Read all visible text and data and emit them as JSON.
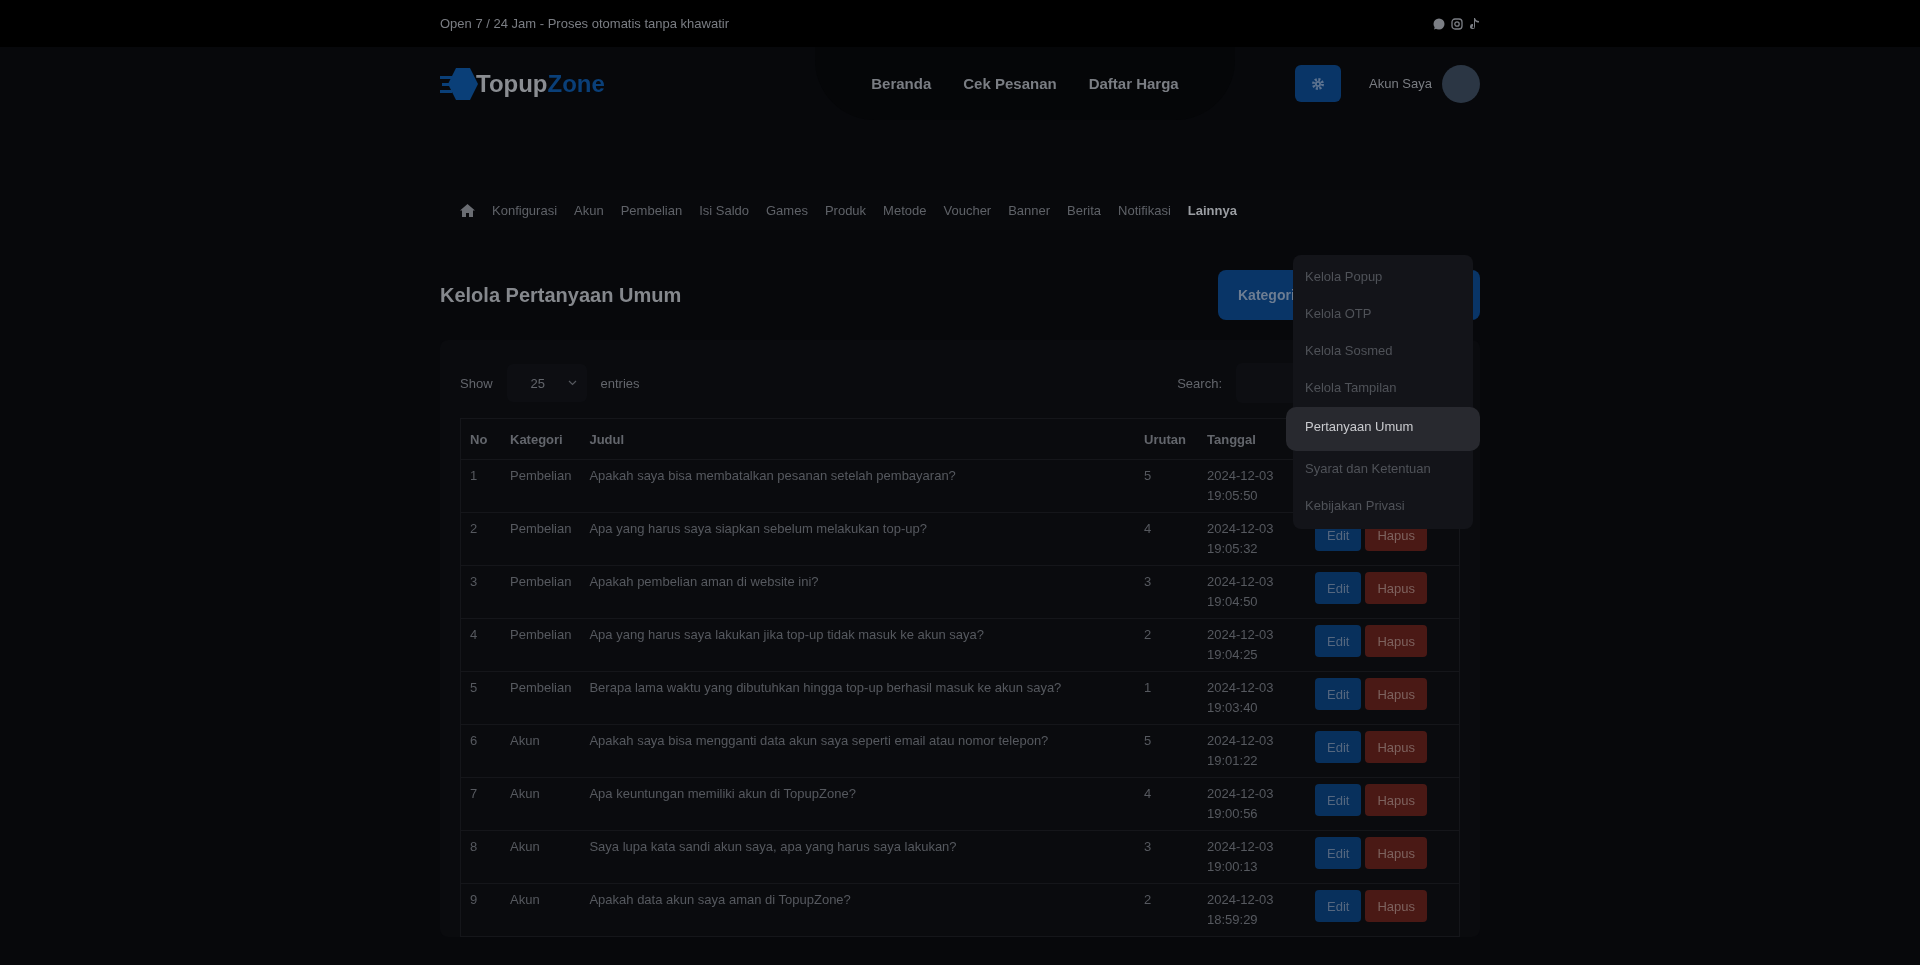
{
  "top_bar": {
    "tagline": "Open 7 / 24 Jam - Proses otomatis tanpa khawatir"
  },
  "header": {
    "logo": {
      "prefix": "Topup",
      "suffix": "Zone"
    },
    "nav": [
      "Beranda",
      "Cek Pesanan",
      "Daftar Harga"
    ],
    "account": "Akun Saya"
  },
  "admin_nav": {
    "items": [
      {
        "label": "Konfigurasi",
        "selected": false
      },
      {
        "label": "Akun",
        "selected": false
      },
      {
        "label": "Pembelian",
        "selected": false
      },
      {
        "label": "Isi Saldo",
        "selected": false
      },
      {
        "label": "Games",
        "selected": false
      },
      {
        "label": "Produk",
        "selected": false
      },
      {
        "label": "Metode",
        "selected": false
      },
      {
        "label": "Voucher",
        "selected": false
      },
      {
        "label": "Banner",
        "selected": false
      },
      {
        "label": "Berita",
        "selected": false
      },
      {
        "label": "Notifikasi",
        "selected": false
      },
      {
        "label": "Lainnya",
        "selected": true
      }
    ]
  },
  "dropdown": {
    "items": [
      {
        "label": "Kelola Popup",
        "selected": false
      },
      {
        "label": "Kelola OTP",
        "selected": false
      },
      {
        "label": "Kelola Sosmed",
        "selected": false
      },
      {
        "label": "Kelola Tampilan",
        "selected": false
      },
      {
        "label": "Pertanyaan Umum",
        "selected": true
      },
      {
        "label": "Syarat dan Ketentuan",
        "selected": false
      },
      {
        "label": "Kebijakan Privasi",
        "selected": false
      }
    ]
  },
  "page": {
    "title": "Kelola Pertanyaan Umum",
    "category_button": "Kategori"
  },
  "table_controls": {
    "show_label": "Show",
    "page_size": "25",
    "entries_label": "entries",
    "search_label": "Search:"
  },
  "table": {
    "columns": [
      "No",
      "Kategori",
      "Judul",
      "Urutan",
      "Tanggal"
    ],
    "rows": [
      {
        "cells": [
          "1",
          "Pembelian",
          "Apakah saya bisa membatalkan pesanan setelah pembayaran?",
          "5",
          "2024-12-03 19:05:50"
        ],
        "actions": []
      },
      {
        "cells": [
          "2",
          "Pembelian",
          "Apa yang harus saya siapkan sebelum melakukan top-up?",
          "4",
          "2024-12-03 19:05:32"
        ],
        "actions": [
          "Edit",
          "Hapus"
        ]
      },
      {
        "cells": [
          "3",
          "Pembelian",
          "Apakah pembelian aman di website ini?",
          "3",
          "2024-12-03 19:04:50"
        ],
        "actions": [
          "Edit",
          "Hapus"
        ]
      },
      {
        "cells": [
          "4",
          "Pembelian",
          "Apa yang harus saya lakukan jika top-up tidak masuk ke akun saya?",
          "2",
          "2024-12-03 19:04:25"
        ],
        "actions": [
          "Edit",
          "Hapus"
        ]
      },
      {
        "cells": [
          "5",
          "Pembelian",
          "Berapa lama waktu yang dibutuhkan hingga top-up berhasil masuk ke akun saya?",
          "1",
          "2024-12-03 19:03:40"
        ],
        "actions": [
          "Edit",
          "Hapus"
        ]
      },
      {
        "cells": [
          "6",
          "Akun",
          "Apakah saya bisa mengganti data akun saya seperti email atau nomor telepon?",
          "5",
          "2024-12-03 19:01:22"
        ],
        "actions": [
          "Edit",
          "Hapus"
        ]
      },
      {
        "cells": [
          "7",
          "Akun",
          "Apa keuntungan memiliki akun di TopupZone?",
          "4",
          "2024-12-03 19:00:56"
        ],
        "actions": [
          "Edit",
          "Hapus"
        ]
      },
      {
        "cells": [
          "8",
          "Akun",
          "Saya lupa kata sandi akun saya, apa yang harus saya lakukan?",
          "3",
          "2024-12-03 19:00:13"
        ],
        "actions": [
          "Edit",
          "Hapus"
        ]
      },
      {
        "cells": [
          "9",
          "Akun",
          "Apakah data akun saya aman di TopupZone?",
          "2",
          "2024-12-03 18:59:29"
        ],
        "actions": [
          "Edit",
          "Hapus"
        ]
      }
    ]
  }
}
